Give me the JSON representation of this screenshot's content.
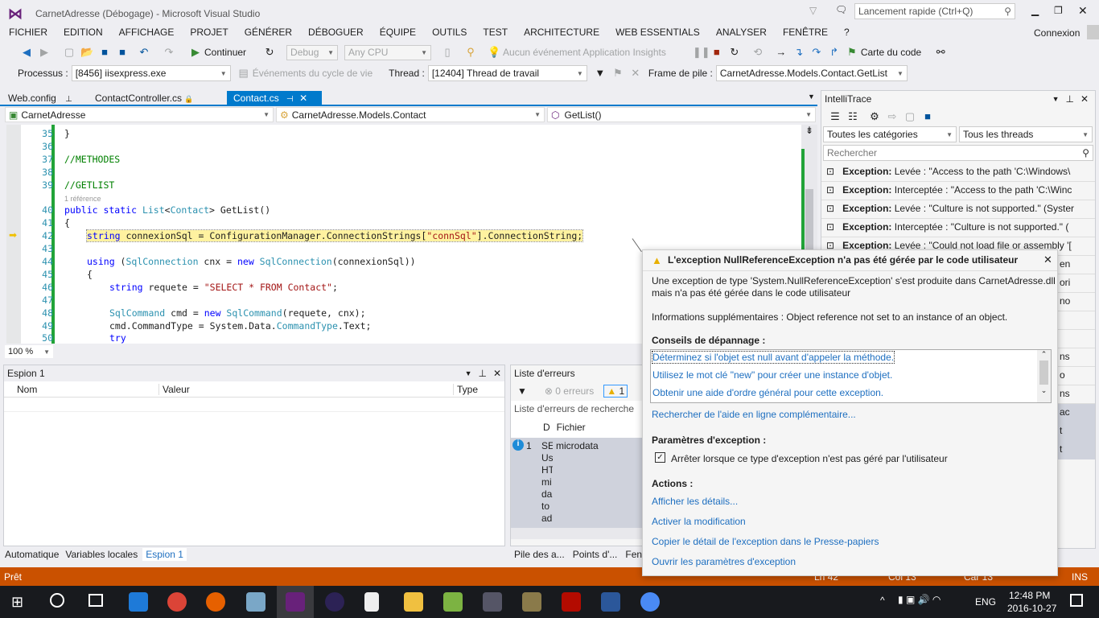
{
  "window": {
    "title": "CarnetAdresse (Débogage) - Microsoft Visual Studio",
    "quick_launch_placeholder": "Lancement rapide (Ctrl+Q)",
    "account": "Connexion"
  },
  "menu": [
    "FICHIER",
    "EDITION",
    "AFFICHAGE",
    "PROJET",
    "GÉNÉRER",
    "DÉBOGUER",
    "ÉQUIPE",
    "OUTILS",
    "TEST",
    "ARCHITECTURE",
    "WEB ESSENTIALS",
    "ANALYSER",
    "FENÊTRE",
    "?"
  ],
  "toolbar": {
    "continue": "Continuer",
    "config": "Debug",
    "platform": "Any CPU",
    "insights": "Aucun événement Application Insights",
    "code_map": "Carte du code"
  },
  "debug_bar": {
    "process_label": "Processus :",
    "process": "[8456] iisexpress.exe",
    "lifecycle": "Événements du cycle de vie",
    "thread_label": "Thread :",
    "thread": "[12404] Thread de travail",
    "stack_label": "Frame de pile :",
    "stack": "CarnetAdresse.Models.Contact.GetList"
  },
  "tabs": [
    {
      "label": "Web.config"
    },
    {
      "label": "ContactController.cs"
    },
    {
      "label": "Contact.cs",
      "active": true
    }
  ],
  "nav": {
    "project": "CarnetAdresse",
    "class": "CarnetAdresse.Models.Contact",
    "member": "GetList()"
  },
  "editor": {
    "zoom": "100 %",
    "current_line": 42,
    "lines": [
      {
        "n": "35",
        "y": 0,
        "ind": 1,
        "t": [
          [
            "}",
            ""
          ]
        ]
      },
      {
        "n": "36",
        "y": 1,
        "ind": 0,
        "t": []
      },
      {
        "n": "37",
        "y": 2,
        "ind": 1,
        "t": [
          [
            "//METHODES",
            "cm"
          ]
        ]
      },
      {
        "n": "38",
        "y": 3,
        "ind": 0,
        "t": []
      },
      {
        "n": "39",
        "y": 4,
        "ind": 1,
        "t": [
          [
            "//GETLIST",
            "cm"
          ]
        ]
      },
      {
        "n": "",
        "y": 5,
        "ind": 1,
        "t": [
          [
            "1 référence",
            "cl"
          ]
        ]
      },
      {
        "n": "40",
        "y": 6,
        "ind": 1,
        "t": [
          [
            "public static ",
            "kw"
          ],
          [
            "List",
            "ty"
          ],
          [
            "<",
            ""
          ],
          [
            "Contact",
            "ty"
          ],
          [
            "> GetList()",
            ""
          ]
        ]
      },
      {
        "n": "41",
        "y": 7,
        "ind": 1,
        "t": [
          [
            "{",
            ""
          ]
        ]
      },
      {
        "n": "42",
        "y": 8,
        "ind": 2,
        "hl": true,
        "t": [
          [
            "string",
            "kw"
          ],
          [
            " connexionSql = ConfigurationManager.ConnectionStrings[",
            ""
          ],
          [
            "\"connSql\"",
            "str"
          ],
          [
            "].ConnectionString;",
            ""
          ]
        ]
      },
      {
        "n": "43",
        "y": 9,
        "ind": 0,
        "t": []
      },
      {
        "n": "44",
        "y": 10,
        "ind": 2,
        "t": [
          [
            "using",
            "kw"
          ],
          [
            " (",
            ""
          ],
          [
            "SqlConnection",
            "ty"
          ],
          [
            " cnx = ",
            ""
          ],
          [
            "new ",
            "kw"
          ],
          [
            "SqlConnection",
            "ty"
          ],
          [
            "(connexionSql))",
            ""
          ]
        ]
      },
      {
        "n": "45",
        "y": 11,
        "ind": 2,
        "t": [
          [
            "{",
            ""
          ]
        ]
      },
      {
        "n": "46",
        "y": 12,
        "ind": 3,
        "t": [
          [
            "string",
            "kw"
          ],
          [
            " requete = ",
            ""
          ],
          [
            "\"SELECT * FROM Contact\"",
            "str"
          ],
          [
            ";",
            ""
          ]
        ]
      },
      {
        "n": "47",
        "y": 13,
        "ind": 0,
        "t": []
      },
      {
        "n": "48",
        "y": 14,
        "ind": 3,
        "t": [
          [
            "SqlCommand",
            "ty"
          ],
          [
            " cmd = ",
            ""
          ],
          [
            "new ",
            "kw"
          ],
          [
            "SqlCommand",
            "ty"
          ],
          [
            "(requete, cnx);",
            ""
          ]
        ]
      },
      {
        "n": "49",
        "y": 15,
        "ind": 3,
        "t": [
          [
            "cmd.CommandType = System.Data.",
            ""
          ],
          [
            "CommandType",
            "ty"
          ],
          [
            ".Text;",
            ""
          ]
        ]
      },
      {
        "n": "50",
        "y": 16,
        "ind": 3,
        "t": [
          [
            "try",
            "kw"
          ]
        ]
      }
    ]
  },
  "watch": {
    "title": "Espion 1",
    "col_name": "Nom",
    "col_value": "Valeur",
    "col_type": "Type"
  },
  "errors": {
    "title": "Liste d'erreurs",
    "errors": "0 erreurs",
    "warnings": "1",
    "search_placeholder": "Liste d'erreurs de recherche",
    "col_d": "D",
    "col_file": "Fichier",
    "row": {
      "num": "1",
      "desc": [
        "SE",
        "Us",
        "HT",
        "mi",
        "da",
        "to",
        "ad"
      ],
      "file": "microdata"
    }
  },
  "bottom_tabs_left": [
    "Automatique",
    "Variables locales",
    "Espion 1"
  ],
  "bottom_tabs_right": [
    "Pile des a...",
    "Points d'...",
    "Fenê"
  ],
  "intellitrace": {
    "title": "IntelliTrace",
    "category": "Toutes les catégories",
    "threads": "Tous les threads",
    "search_placeholder": "Rechercher",
    "events": [
      {
        "k": "Exception:",
        "v": " Levée : \"Access to the path 'C:\\Windows\\"
      },
      {
        "k": "Exception:",
        "v": " Interceptée : \"Access to the path 'C:\\Winc"
      },
      {
        "k": "Exception:",
        "v": " Levée : \"Culture is not supported.\" (Syster"
      },
      {
        "k": "Exception:",
        "v": " Interceptée : \"Culture is not supported.\" ("
      },
      {
        "k": "Exception:",
        "v": " Levée : \"Could not load file or assembly '["
      }
    ],
    "peek": [
      "en",
      "ori",
      "no",
      "",
      "",
      "ns",
      "o",
      "ns",
      "ac",
      "t",
      "t"
    ]
  },
  "exception": {
    "title": "L'exception NullReferenceException n'a pas été gérée par le code utilisateur",
    "desc1": "Une exception de type 'System.NullReferenceException' s'est produite dans CarnetAdresse.dll",
    "desc2": "mais n'a pas été gérée dans le code utilisateur",
    "info": "Informations supplémentaires : Object reference not set to an instance of an object.",
    "tips_title": "Conseils de dépannage :",
    "tips": [
      "Déterminez si l'objet est null avant d'appeler la méthode.",
      "Utilisez le mot clé \"new\" pour créer une instance d'objet.",
      "Obtenir une aide d'ordre général pour cette exception."
    ],
    "search_help": "Rechercher de l'aide en ligne complémentaire...",
    "settings_title": "Paramètres d'exception :",
    "break_checkbox": "Arrêter lorsque ce type d'exception n'est pas géré par l'utilisateur",
    "break_checked": true,
    "actions_title": "Actions :",
    "actions": [
      "Afficher les détails...",
      "Activer la modification",
      "Copier le détail de l'exception dans le Presse-papiers",
      "Ouvrir les paramètres d'exception"
    ]
  },
  "status": {
    "text": "Prêt",
    "ln": "Ln 42",
    "col": "Col 13",
    "car": "Car 13",
    "mode": "INS"
  },
  "taskbar": {
    "lang": "ENG",
    "time": "12:48 PM",
    "date": "2016-10-27"
  },
  "colors": {
    "accent": "#007acc",
    "status": "#ca5100",
    "link": "#1e6fc0"
  }
}
